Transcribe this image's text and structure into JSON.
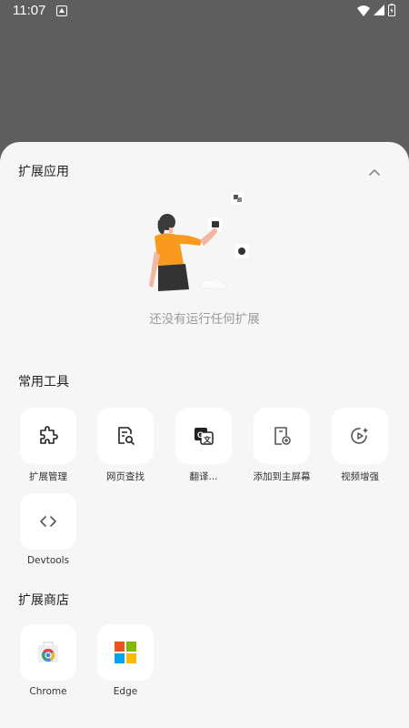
{
  "status_bar": {
    "time": "11:07"
  },
  "extensions": {
    "title": "扩展应用",
    "empty_text": "还没有运行任何扩展"
  },
  "common_tools": {
    "title": "常用工具",
    "items": [
      {
        "label": "扩展管理",
        "icon": "puzzle-icon"
      },
      {
        "label": "网页查找",
        "icon": "page-search-icon"
      },
      {
        "label": "翻译...",
        "icon": "translate-icon"
      },
      {
        "label": "添加到主屏幕",
        "icon": "add-to-home-icon"
      },
      {
        "label": "视频增强",
        "icon": "video-enhance-icon"
      },
      {
        "label": "Devtools",
        "icon": "code-icon"
      }
    ]
  },
  "store": {
    "title": "扩展商店",
    "items": [
      {
        "label": "Chrome",
        "icon": "chrome-store-icon"
      },
      {
        "label": "Edge",
        "icon": "edge-store-icon"
      }
    ]
  }
}
